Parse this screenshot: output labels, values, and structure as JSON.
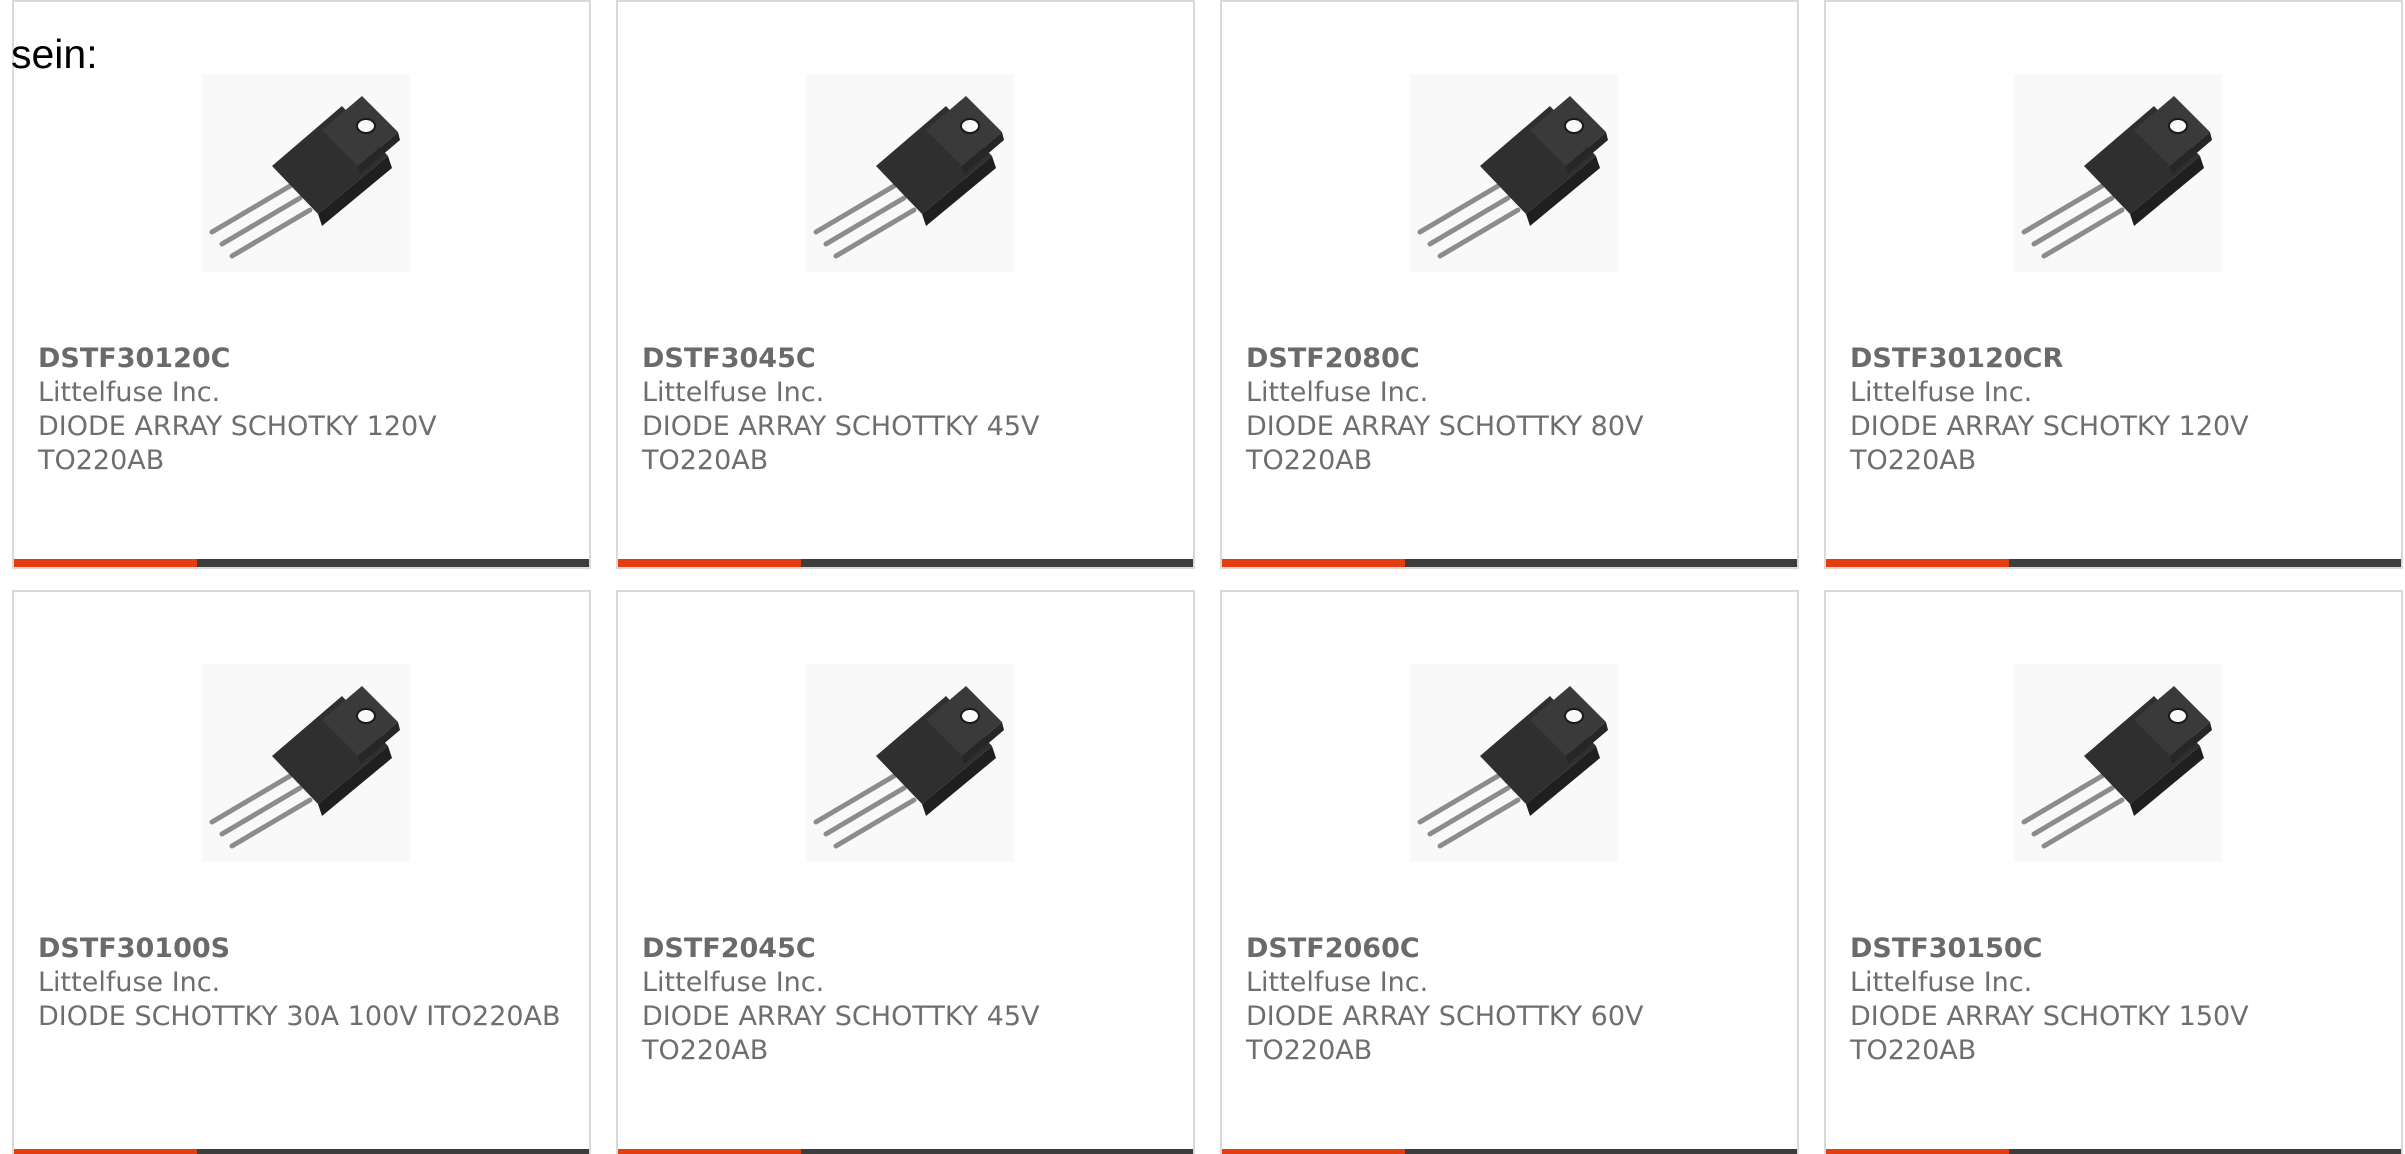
{
  "intro": {
    "text": "sein:"
  },
  "colors": {
    "accent": "#e33d12",
    "bar": "#3d3d3d",
    "border": "#d9d9d9",
    "text": "#6e6e6e"
  },
  "products": [
    {
      "part": "DSTF30120C",
      "manufacturer": "Littelfuse Inc.",
      "description": "DIODE ARRAY SCHOTKY 120V TO220AB",
      "image_icon": "to220-transistor-icon"
    },
    {
      "part": "DSTF3045C",
      "manufacturer": "Littelfuse Inc.",
      "description": "DIODE ARRAY SCHOTTKY 45V TO220AB",
      "image_icon": "to220-transistor-icon"
    },
    {
      "part": "DSTF2080C",
      "manufacturer": "Littelfuse Inc.",
      "description": "DIODE ARRAY SCHOTTKY 80V TO220AB",
      "image_icon": "to220-transistor-icon"
    },
    {
      "part": "DSTF30120CR",
      "manufacturer": "Littelfuse Inc.",
      "description": "DIODE ARRAY SCHOTKY 120V TO220AB",
      "image_icon": "to220-transistor-icon"
    },
    {
      "part": "DSTF30100S",
      "manufacturer": "Littelfuse Inc.",
      "description": "DIODE SCHOTTKY 30A 100V ITO220AB",
      "image_icon": "to220-transistor-icon"
    },
    {
      "part": "DSTF2045C",
      "manufacturer": "Littelfuse Inc.",
      "description": "DIODE ARRAY SCHOTTKY 45V TO220AB",
      "image_icon": "to220-transistor-icon"
    },
    {
      "part": "DSTF2060C",
      "manufacturer": "Littelfuse Inc.",
      "description": "DIODE ARRAY SCHOTTKY 60V TO220AB",
      "image_icon": "to220-transistor-icon"
    },
    {
      "part": "DSTF30150C",
      "manufacturer": "Littelfuse Inc.",
      "description": "DIODE ARRAY SCHOTKY 150V TO220AB",
      "image_icon": "to220-transistor-icon"
    }
  ]
}
